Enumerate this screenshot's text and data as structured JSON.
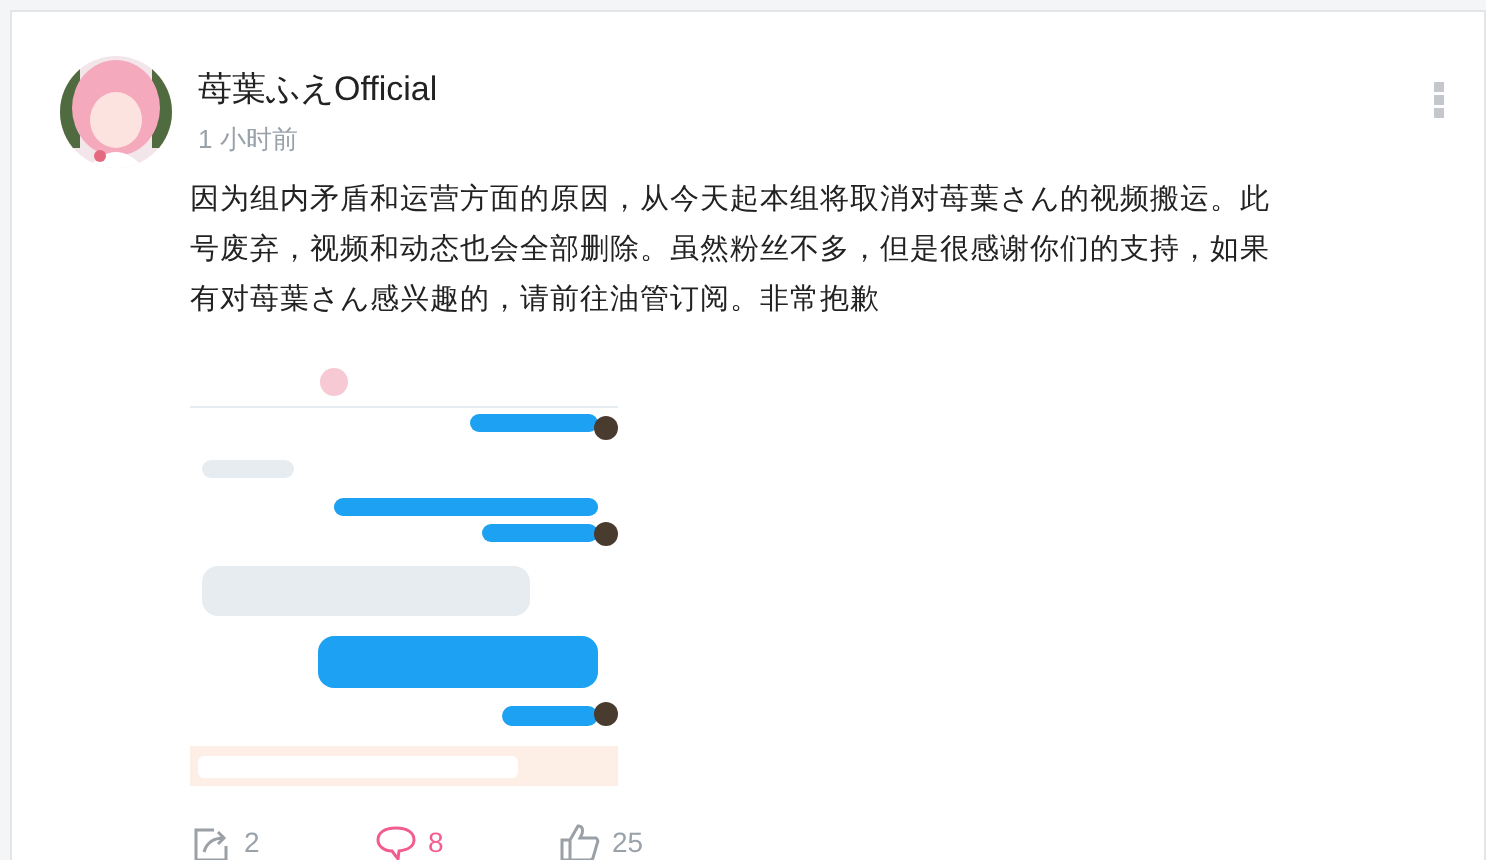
{
  "post": {
    "author": "苺葉ふえOfficial",
    "time": "1 小时前",
    "text": "因为组内矛盾和运营方面的原因，从今天起本组将取消对苺葉さん的视频搬运。此号废弃，视频和动态也会全部删除。虽然粉丝不多，但是很感谢你们的支持，如果有对苺葉さん感兴趣的，请前往油管订阅。非常抱歉"
  },
  "actions": [
    {
      "kind": "share",
      "count": "2"
    },
    {
      "kind": "comment",
      "count": "8"
    },
    {
      "kind": "like",
      "count": "25"
    }
  ]
}
